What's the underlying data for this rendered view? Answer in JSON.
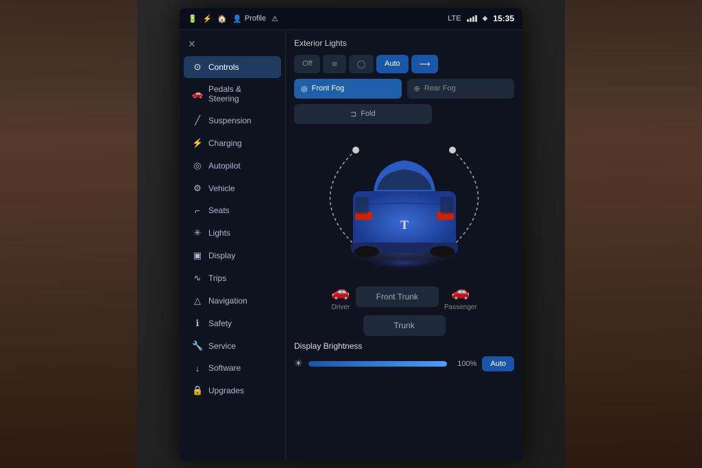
{
  "statusBar": {
    "icons": [
      "battery",
      "lightning",
      "home",
      "profile",
      "alert"
    ],
    "profileLabel": "Profile",
    "signal": "LTE",
    "bluetooth": "BT",
    "time": "15:35"
  },
  "sidebar": {
    "closeLabel": "✕",
    "items": [
      {
        "id": "controls",
        "icon": "🎮",
        "label": "Controls",
        "active": true
      },
      {
        "id": "pedals",
        "icon": "🚗",
        "label": "Pedals & Steering",
        "active": false
      },
      {
        "id": "suspension",
        "icon": "🔧",
        "label": "Suspension",
        "active": false
      },
      {
        "id": "charging",
        "icon": "⚡",
        "label": "Charging",
        "active": false
      },
      {
        "id": "autopilot",
        "icon": "🤖",
        "label": "Autopilot",
        "active": false
      },
      {
        "id": "vehicle",
        "icon": "⚙",
        "label": "Vehicle",
        "active": false
      },
      {
        "id": "seats",
        "icon": "💺",
        "label": "Seats",
        "active": false
      },
      {
        "id": "lights",
        "icon": "✨",
        "label": "Lights",
        "active": false
      },
      {
        "id": "display",
        "icon": "🖥",
        "label": "Display",
        "active": false
      },
      {
        "id": "trips",
        "icon": "📊",
        "label": "Trips",
        "active": false
      },
      {
        "id": "navigation",
        "icon": "🧭",
        "label": "Navigation",
        "active": false
      },
      {
        "id": "safety",
        "icon": "🛡",
        "label": "Safety",
        "active": false
      },
      {
        "id": "service",
        "icon": "🔩",
        "label": "Service",
        "active": false
      },
      {
        "id": "software",
        "icon": "💾",
        "label": "Software",
        "active": false
      },
      {
        "id": "upgrades",
        "icon": "🔒",
        "label": "Upgrades",
        "active": false
      }
    ]
  },
  "panel": {
    "sectionTitle": "Exterior Lights",
    "lightButtons": [
      {
        "id": "off",
        "label": "Off",
        "active": false
      },
      {
        "id": "parking",
        "label": "≫",
        "active": false
      },
      {
        "id": "lowbeam",
        "label": "◯",
        "active": false
      },
      {
        "id": "auto",
        "label": "Auto",
        "active": true
      },
      {
        "id": "highbeam",
        "label": "⟵",
        "active": true,
        "selected": true
      }
    ],
    "fogButtons": [
      {
        "id": "front-fog",
        "label": "Front Fog",
        "active": true
      },
      {
        "id": "rear-fog",
        "label": "Rear Fog",
        "active": false
      }
    ],
    "foldButton": {
      "label": "Fold",
      "icon": "⊏"
    },
    "carAlt": "Tesla car rear view",
    "doorLabels": {
      "driver": "Driver",
      "passenger": "Passenger"
    },
    "trunkButtons": [
      {
        "id": "front-trunk",
        "label": "Front Trunk"
      },
      {
        "id": "trunk",
        "label": "Trunk"
      }
    ],
    "brightnessSection": {
      "title": "Display Brightness",
      "percentage": "100%",
      "autoLabel": "Auto"
    }
  }
}
